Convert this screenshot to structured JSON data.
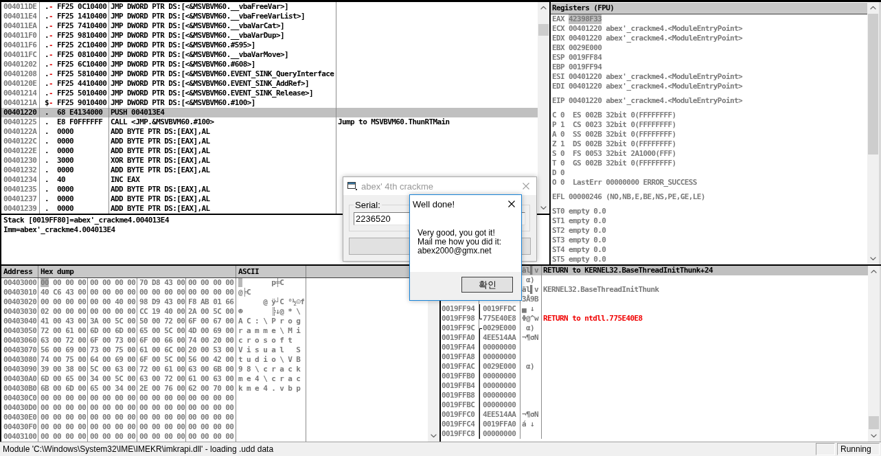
{
  "disassembly": {
    "rows": [
      {
        "address": "004011DE",
        "marker": ".",
        "jump": "-",
        "bytes": "FF25 0C10400",
        "instruction": "JMP DWORD PTR DS:[<&MSVBVM60.__vbaFreeVar>]",
        "selected": false
      },
      {
        "address": "004011E4",
        "marker": ".",
        "jump": "-",
        "bytes": "FF25 1410400",
        "instruction": "JMP DWORD PTR DS:[<&MSVBVM60.__vbaFreeVarList>]",
        "selected": false
      },
      {
        "address": "004011EA",
        "marker": ".",
        "jump": "-",
        "bytes": "FF25 7410400",
        "instruction": "JMP DWORD PTR DS:[<&MSVBVM60.__vbaVarCat>]",
        "selected": false
      },
      {
        "address": "004011F0",
        "marker": ".",
        "jump": "-",
        "bytes": "FF25 9810400",
        "instruction": "JMP DWORD PTR DS:[<&MSVBVM60.__vbaVarDup>]",
        "selected": false
      },
      {
        "address": "004011F6",
        "marker": ".",
        "jump": "-",
        "bytes": "FF25 2C10400",
        "instruction": "JMP DWORD PTR DS:[<&MSVBVM60.#595>]",
        "selected": false
      },
      {
        "address": "004011FC",
        "marker": ".",
        "jump": "-",
        "bytes": "FF25 0810400",
        "instruction": "JMP DWORD PTR DS:[<&MSVBVM60.__vbaVarMove>]",
        "selected": false
      },
      {
        "address": "00401202",
        "marker": ".",
        "jump": "-",
        "bytes": "FF25 6C10400",
        "instruction": "JMP DWORD PTR DS:[<&MSVBVM60.#608>]",
        "selected": false
      },
      {
        "address": "00401208",
        "marker": ".",
        "jump": "-",
        "bytes": "FF25 5810400",
        "instruction": "JMP DWORD PTR DS:[<&MSVBVM60.EVENT_SINK_QueryInterface",
        "selected": false
      },
      {
        "address": "0040120E",
        "marker": ".",
        "jump": "-",
        "bytes": "FF25 4410400",
        "instruction": "JMP DWORD PTR DS:[<&MSVBVM60.EVENT_SINK_AddRef>]",
        "selected": false
      },
      {
        "address": "00401214",
        "marker": ".",
        "jump": "-",
        "bytes": "FF25 5010400",
        "instruction": "JMP DWORD PTR DS:[<&MSVBVM60.EVENT_SINK_Release>]",
        "selected": false
      },
      {
        "address": "0040121A",
        "marker": "$",
        "jump": "-",
        "bytes": "FF25 9010400",
        "instruction": "JMP DWORD PTR DS:[<&MSVBVM60.#100>]",
        "selected": false
      },
      {
        "address": "00401220",
        "marker": ".",
        "bytes": "68 E4134000",
        "instruction": "PUSH 004013E4",
        "selected": true
      },
      {
        "address": "00401225",
        "marker": ".",
        "bytes": "E8 F0FFFFFF",
        "instruction": "CALL <JMP.&MSVBVM60.#100>",
        "comment": "Jump to MSVBVM60.ThunRTMain",
        "selected": false
      },
      {
        "address": "0040122A",
        "marker": ".",
        "bytes": "0000",
        "instruction": "ADD BYTE PTR DS:[EAX],AL",
        "selected": false
      },
      {
        "address": "0040122C",
        "marker": ".",
        "bytes": "0000",
        "instruction": "ADD BYTE PTR DS:[EAX],AL",
        "selected": false
      },
      {
        "address": "0040122E",
        "marker": ".",
        "bytes": "0000",
        "instruction": "ADD BYTE PTR DS:[EAX],AL",
        "selected": false
      },
      {
        "address": "00401230",
        "marker": ".",
        "bytes": "3000",
        "instruction": "XOR BYTE PTR DS:[EAX],AL",
        "selected": false
      },
      {
        "address": "00401232",
        "marker": ".",
        "bytes": "0000",
        "instruction": "ADD BYTE PTR DS:[EAX],AL",
        "selected": false
      },
      {
        "address": "00401234",
        "marker": ".",
        "bytes": "40",
        "instruction": "INC EAX",
        "selected": false
      },
      {
        "address": "00401235",
        "marker": ".",
        "bytes": "0000",
        "instruction": "ADD BYTE PTR DS:[EAX],AL",
        "selected": false
      },
      {
        "address": "00401237",
        "marker": ".",
        "bytes": "0000",
        "instruction": "ADD BYTE PTR DS:[EAX],AL",
        "selected": false
      },
      {
        "address": "00401239",
        "marker": ".",
        "bytes": "0000",
        "instruction": "ADD BYTE PTR DS:[EAX],AL",
        "selected": false
      }
    ]
  },
  "info_pane": {
    "lines": [
      "Stack [0019FF80]=abex'_crackme4.004013E4",
      "Imm=abex'_crackme4.004013E4"
    ]
  },
  "registers": {
    "title": "Registers (FPU)",
    "groups": [
      {
        "lines": [
          {
            "kind": "register",
            "name": "EAX",
            "value": "42398F33",
            "selected": true
          },
          {
            "kind": "register",
            "name": "ECX",
            "value": "00401220",
            "comment": "abex'_crackme4.<ModuleEntryPoint>",
            "selected": false
          },
          {
            "kind": "register",
            "name": "EDX",
            "value": "00401220",
            "comment": "abex'_crackme4.<ModuleEntryPoint>",
            "selected": false
          },
          {
            "kind": "register",
            "name": "EBX",
            "value": "0029E000",
            "selected": false
          },
          {
            "kind": "register",
            "name": "ESP",
            "value": "0019FF84",
            "selected": false
          },
          {
            "kind": "register",
            "name": "EBP",
            "value": "0019FF94",
            "selected": false
          },
          {
            "kind": "register",
            "name": "ESI",
            "value": "00401220",
            "comment": "abex'_crackme4.<ModuleEntryPoint>",
            "selected": false
          },
          {
            "kind": "register",
            "name": "EDI",
            "value": "00401220",
            "comment": "abex'_crackme4.<ModuleEntryPoint>",
            "selected": false
          }
        ]
      },
      {
        "lines": [
          {
            "kind": "register",
            "name": "EIP",
            "value": "00401220",
            "comment": "abex'_crackme4.<ModuleEntryPoint>",
            "selected": false
          }
        ]
      },
      {
        "lines": [
          {
            "kind": "flag",
            "name": "C",
            "value": "0",
            "comment": "ES 002B 32bit 0(FFFFFFFF)",
            "selected": false
          },
          {
            "kind": "flag",
            "name": "P",
            "value": "1",
            "comment": "CS 0023 32bit 0(FFFFFFFF)",
            "selected": false
          },
          {
            "kind": "flag",
            "name": "A",
            "value": "0",
            "comment": "SS 002B 32bit 0(FFFFFFFF)",
            "selected": false
          },
          {
            "kind": "flag",
            "name": "Z",
            "value": "1",
            "comment": "DS 002B 32bit 0(FFFFFFFF)",
            "selected": false
          },
          {
            "kind": "flag",
            "name": "S",
            "value": "0",
            "comment": "FS 0053 32bit 2A1000(FFF)",
            "selected": false
          },
          {
            "kind": "flag",
            "name": "T",
            "value": "0",
            "comment": "GS 002B 32bit 0(FFFFFFFF)",
            "selected": false
          },
          {
            "kind": "flag",
            "name": "D",
            "value": "0",
            "selected": false
          },
          {
            "kind": "flag",
            "name": "O",
            "value": "0",
            "comment": "LastErr 00000000 ERROR_SUCCESS",
            "selected": false
          }
        ]
      },
      {
        "lines": [
          {
            "kind": "register",
            "name": "EFL",
            "value": "00000246",
            "comment": "(NO,NB,E,BE,NS,PE,GE,LE)",
            "selected": false
          }
        ]
      },
      {
        "lines": [
          {
            "kind": "register",
            "name": "ST0",
            "value": "empty",
            "comment": "0.0",
            "selected": false
          },
          {
            "kind": "register",
            "name": "ST1",
            "value": "empty",
            "comment": "0.0",
            "selected": false
          },
          {
            "kind": "register",
            "name": "ST2",
            "value": "empty",
            "comment": "0.0",
            "selected": false
          },
          {
            "kind": "register",
            "name": "ST3",
            "value": "empty",
            "comment": "0.0",
            "selected": false
          },
          {
            "kind": "register",
            "name": "ST4",
            "value": "empty",
            "comment": "0.0",
            "selected": false
          },
          {
            "kind": "register",
            "name": "ST5",
            "value": "empty",
            "comment": "0.0",
            "selected": false
          }
        ]
      }
    ]
  },
  "dump": {
    "columns": [
      "Address",
      "Hex dump",
      "ASCII"
    ],
    "rows": [
      {
        "address": "00403000",
        "bytes": "00 00 00 00 00 00 00 00 70 D8 43 00 00 00 00 00",
        "ascii": "        p╪C",
        "selected": true
      },
      {
        "address": "00403010",
        "bytes": "40 C6 43 00 00 00 00 00 00 00 00 00 00 00 00 00",
        "ascii": "@╞C",
        "selected": false
      },
      {
        "address": "00403020",
        "bytes": "00 00 00 00 00 00 40 00 98 D9 43 00 F8 AB 01 66",
        "ascii": "      @ ÿ┘C °½☺f",
        "selected": false
      },
      {
        "address": "00403030",
        "bytes": "02 00 00 00 00 00 00 00 CC 19 40 00 2A 00 5C 00",
        "ascii": "☻       ╠↓@ * \\",
        "selected": false
      },
      {
        "address": "00403040",
        "bytes": "41 00 43 00 3A 00 5C 00 50 00 72 00 6F 00 67 00",
        "ascii": "A C : \\ P r o g",
        "selected": false
      },
      {
        "address": "00403050",
        "bytes": "72 00 61 00 6D 00 6D 00 65 00 5C 00 4D 00 69 00",
        "ascii": "r a m m e \\ M i",
        "selected": false
      },
      {
        "address": "00403060",
        "bytes": "63 00 72 00 6F 00 73 00 6F 00 66 00 74 00 20 00",
        "ascii": "c r o s o f t",
        "selected": false
      },
      {
        "address": "00403070",
        "bytes": "56 00 69 00 73 00 75 00 61 00 6C 00 20 00 53 00",
        "ascii": "V i s u a l   S",
        "selected": false
      },
      {
        "address": "00403080",
        "bytes": "74 00 75 00 64 00 69 00 6F 00 5C 00 56 00 42 00",
        "ascii": "t u d i o \\ V B",
        "selected": false
      },
      {
        "address": "00403090",
        "bytes": "39 00 38 00 5C 00 63 00 72 00 61 00 63 00 6B 00",
        "ascii": "9 8 \\ c r a c k",
        "selected": false
      },
      {
        "address": "004030A0",
        "bytes": "6D 00 65 00 34 00 5C 00 63 00 72 00 61 00 63 00",
        "ascii": "m e 4 \\ c r a c",
        "selected": false
      },
      {
        "address": "004030B0",
        "bytes": "6B 00 6D 00 65 00 34 00 2E 00 76 00 62 00 70 00",
        "ascii": "k m e 4 . v b p",
        "selected": false
      },
      {
        "address": "004030C0",
        "bytes": "00 00 00 00 00 00 00 00 00 00 00 00 00 00 00 00",
        "selected": false
      },
      {
        "address": "004030D0",
        "bytes": "00 00 00 00 00 00 00 00 00 00 00 00 00 00 00 00",
        "selected": false
      },
      {
        "address": "004030E0",
        "bytes": "00 00 00 00 00 00 00 00 00 00 00 00 00 00 00 00",
        "selected": false
      },
      {
        "address": "004030F0",
        "bytes": "00 00 00 00 00 00 00 00 00 00 00 00 00 00 00 00",
        "selected": false
      },
      {
        "address": "00403100",
        "bytes": "00 00 00 00 00 00 00 00 00 00 00 00 00 00 00 00",
        "selected": false
      }
    ]
  },
  "stack": {
    "rows": [
      {
        "ascii": "äl▌v",
        "comment": {
          "text": "RETURN to KERNEL32.BaseThreadInitThunk+24",
          "kind": "return"
        },
        "selected": true
      },
      {
        "ascii": " α)",
        "selected": false
      },
      {
        "ascii": "äl▌v",
        "comment": {
          "text": "KERNEL32.BaseThreadInitThunk",
          "kind": "symbol"
        },
        "selected": false
      },
      {
        "ascii": "3Å9B",
        "selected": false
      },
      {
        "address": "0019FF94",
        "frame": {
          "kind": "line"
        },
        "value": "0019FFDC",
        "ascii": "▄ ↓",
        "selected": false
      },
      {
        "address": "0019FF98",
        "frame": {
          "kind": "end"
        },
        "value": "775E40E8",
        "ascii": "Φ@^w",
        "comment": {
          "text": "RETURN to ntdll.775E40E8",
          "kind": "return"
        },
        "selected": false
      },
      {
        "address": "0019FF9C",
        "frame": {
          "kind": "start"
        },
        "value": "0029E000",
        "ascii": " α)",
        "selected": false
      },
      {
        "address": "0019FFA0",
        "frame": {
          "kind": "line"
        },
        "value": "4EE514AA",
        "ascii": "¬¶σN",
        "selected": false
      },
      {
        "address": "0019FFA4",
        "frame": {
          "kind": "line"
        },
        "value": "00000000",
        "selected": false
      },
      {
        "address": "0019FFA8",
        "frame": {
          "kind": "line"
        },
        "value": "00000000",
        "selected": false
      },
      {
        "address": "0019FFAC",
        "frame": {
          "kind": "line"
        },
        "value": "0029E000",
        "ascii": " α)",
        "selected": false
      },
      {
        "address": "0019FFB0",
        "frame": {
          "kind": "line"
        },
        "value": "00000000",
        "selected": false
      },
      {
        "address": "0019FFB4",
        "frame": {
          "kind": "line"
        },
        "value": "00000000",
        "selected": false
      },
      {
        "address": "0019FFB8",
        "frame": {
          "kind": "line"
        },
        "value": "00000000",
        "selected": false
      },
      {
        "address": "0019FFBC",
        "frame": {
          "kind": "line"
        },
        "value": "00000000",
        "selected": false
      },
      {
        "address": "0019FFC0",
        "frame": {
          "kind": "line"
        },
        "value": "4EE514AA",
        "ascii": "¬¶σN",
        "selected": false
      },
      {
        "address": "0019FFC4",
        "frame": {
          "kind": "line"
        },
        "value": "0019FFA0",
        "ascii": "á ↓",
        "selected": false
      },
      {
        "address": "0019FFC8",
        "frame": {
          "kind": "line"
        },
        "value": "00000000",
        "selected": false
      }
    ]
  },
  "status_bar": {
    "message": "Module 'C:\\Windows\\System32\\IME\\IMEKR\\imkrapi.dll' - loading .udd data",
    "state": "Running"
  },
  "crackme_window": {
    "title": "abex' 4th crackme",
    "active": false,
    "group_label": "Serial:",
    "serial": "2236520"
  },
  "message_box": {
    "title": "Well done!",
    "active": true,
    "lines": [
      "Very good, you got it!",
      "Mail me how you did it:",
      "abex2000@gmx.net"
    ],
    "button": "확인"
  }
}
